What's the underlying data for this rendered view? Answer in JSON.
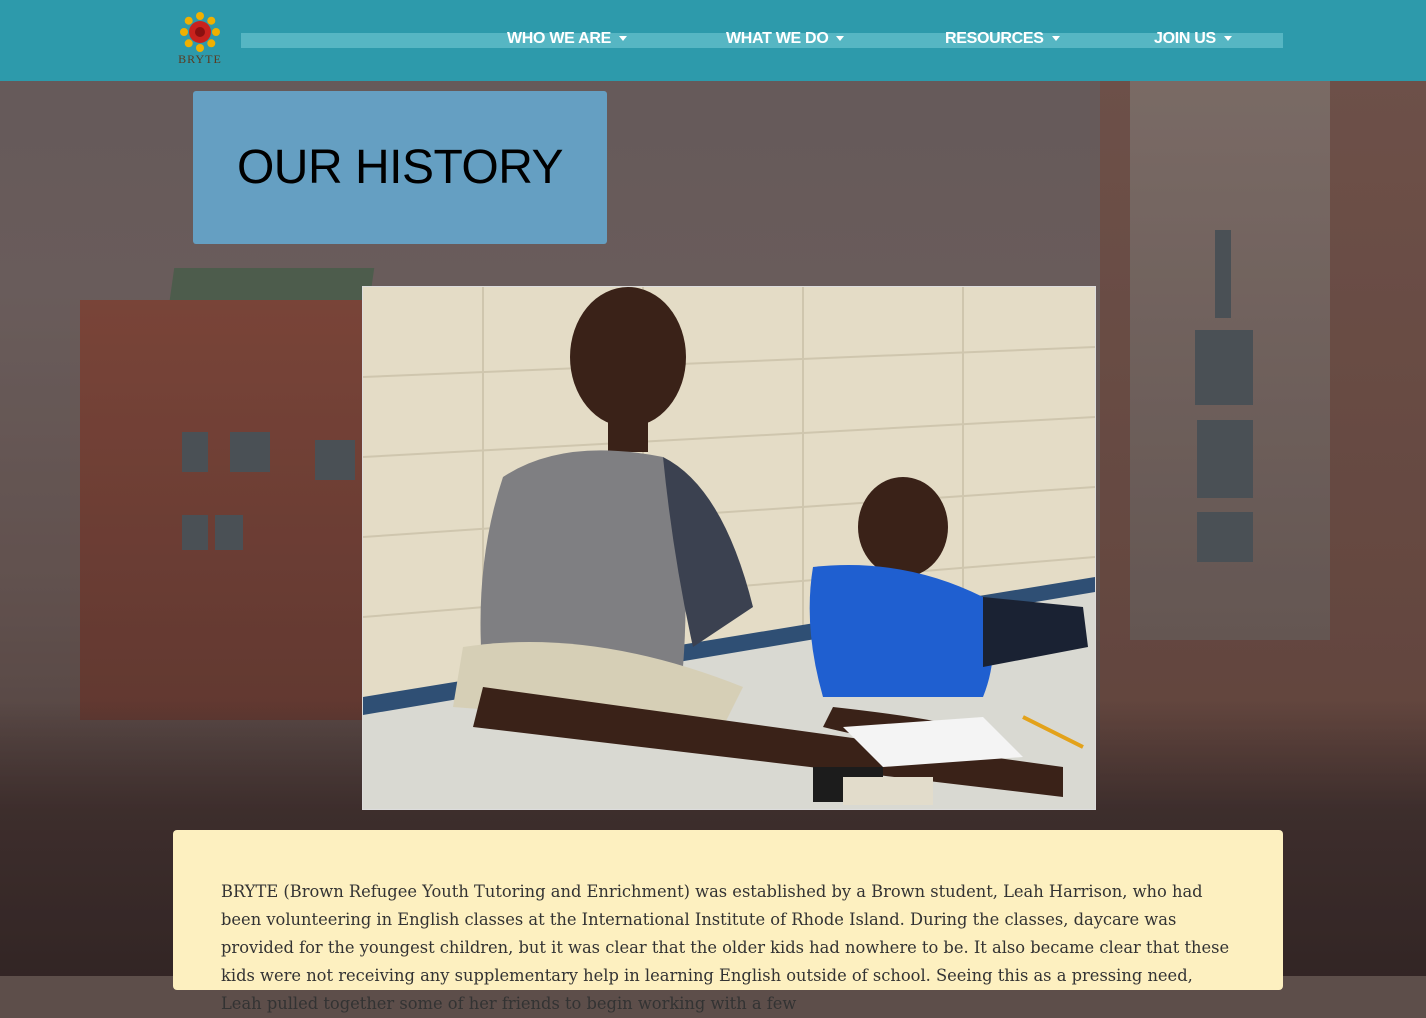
{
  "brand": {
    "name": "BRYTE"
  },
  "nav": {
    "items": [
      {
        "label": "WHO WE ARE"
      },
      {
        "label": "WHAT WE DO"
      },
      {
        "label": "RESOURCES"
      },
      {
        "label": "JOIN US"
      }
    ]
  },
  "page": {
    "title": "OUR HISTORY"
  },
  "content": {
    "paragraph": "BRYTE (Brown Refugee Youth Tutoring and Enrichment) was established by a Brown student, Leah Harrison, who had been volunteering in English classes at the International Institute of Rhode Island. During the classes, daycare was provided for the youngest children, but it was clear that the older kids had nowhere to be. It also became clear that these kids were not receiving any supplementary help in learning English outside of school. Seeing this as a pressing need, Leah pulled together some of her friends to begin working with a few"
  },
  "colors": {
    "navbar": "#28a0b2",
    "title_box": "#659fc2",
    "card": "#fdf0c0"
  }
}
